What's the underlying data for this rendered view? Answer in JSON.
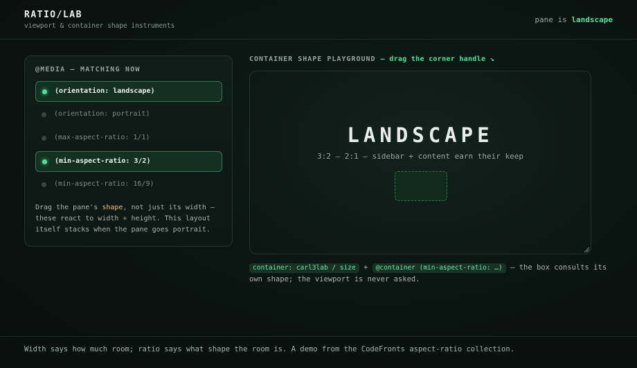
{
  "header": {
    "title": "RATIO/LAB",
    "subtitle": "viewport & container shape instruments",
    "status_prefix": "pane is",
    "status_value": "landscape"
  },
  "media_panel": {
    "title": "@MEDIA — MATCHING NOW",
    "queries": [
      {
        "label": "(orientation: landscape)",
        "active": true
      },
      {
        "label": "(orientation: portrait)",
        "active": false
      },
      {
        "label": "(max-aspect-ratio: 1/1)",
        "active": false
      },
      {
        "label": "(min-aspect-ratio: 3/2)",
        "active": true
      },
      {
        "label": "(min-aspect-ratio: 16/9)",
        "active": false
      }
    ],
    "note_pre": "Drag the pane's ",
    "note_highlight": "shape",
    "note_post": ", not just its width — these react to width ÷ height. This layout itself stacks when the pane goes portrait."
  },
  "playground": {
    "label": "CONTAINER SHAPE PLAYGROUND",
    "hint": "— drag the corner handle ↘",
    "shape_name": "LANDSCAPE",
    "shape_desc": "3:2 – 2:1 — sidebar + content earn their keep",
    "chip_container": "container: carl3lab / size",
    "plus": "+",
    "chip_query": "@container (min-aspect-ratio: …)",
    "explanation": "— the box consults its own shape; the viewport is never asked."
  },
  "footer": {
    "text": "Width says how much room; ratio says what shape the room is. A demo from the CodeFronts aspect-ratio collection."
  },
  "colors": {
    "accent": "#4be39a",
    "highlight": "#e3c468",
    "background": "#0b1411"
  },
  "icons": {
    "resize": "resize-handle-icon",
    "active_dot": "status-dot-icon"
  }
}
